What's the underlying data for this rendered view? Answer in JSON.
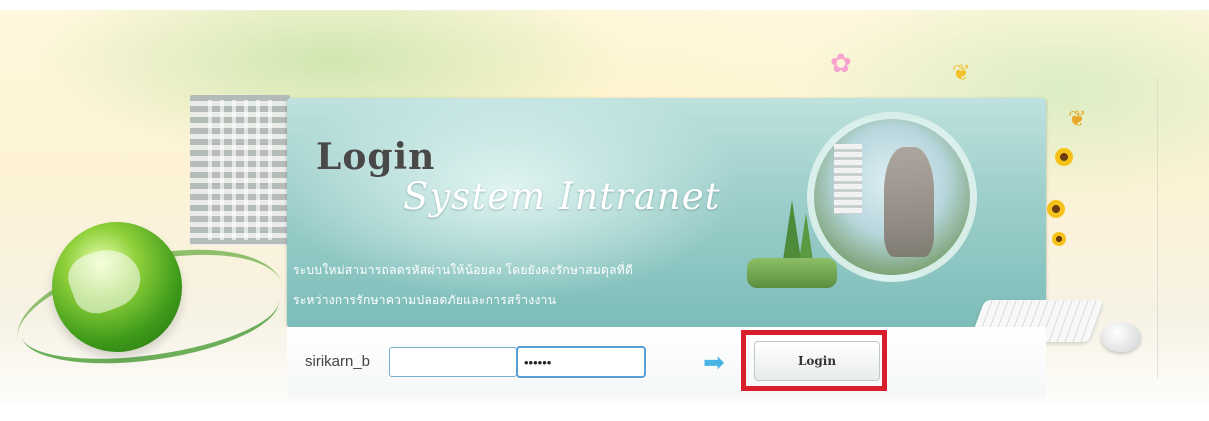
{
  "banner": {
    "title": "Login",
    "subtitle": "System Intranet",
    "description_line1": "ระบบใหม่สามารถลดรหัสผ่านให้น้อยลง โดยยังคงรักษาสมดุลที่ดี",
    "description_line2": "ระหว่างการรักษาความปลอดภัยและการสร้างงาน"
  },
  "login_form": {
    "username_label": "sirikarn_b",
    "username_value": "",
    "password_value": "••••••",
    "login_button_label": "Login"
  },
  "colors": {
    "banner_teal": "#9fd0cc",
    "highlight_red": "#d81e2a",
    "arrow_blue": "#49b4e6",
    "input_border_blue": "#5a9fd4"
  },
  "icons": {
    "arrow": "arrow-right-icon",
    "globe": "globe-icon",
    "butterfly": "butterfly-icon",
    "flower": "flower-icon"
  }
}
